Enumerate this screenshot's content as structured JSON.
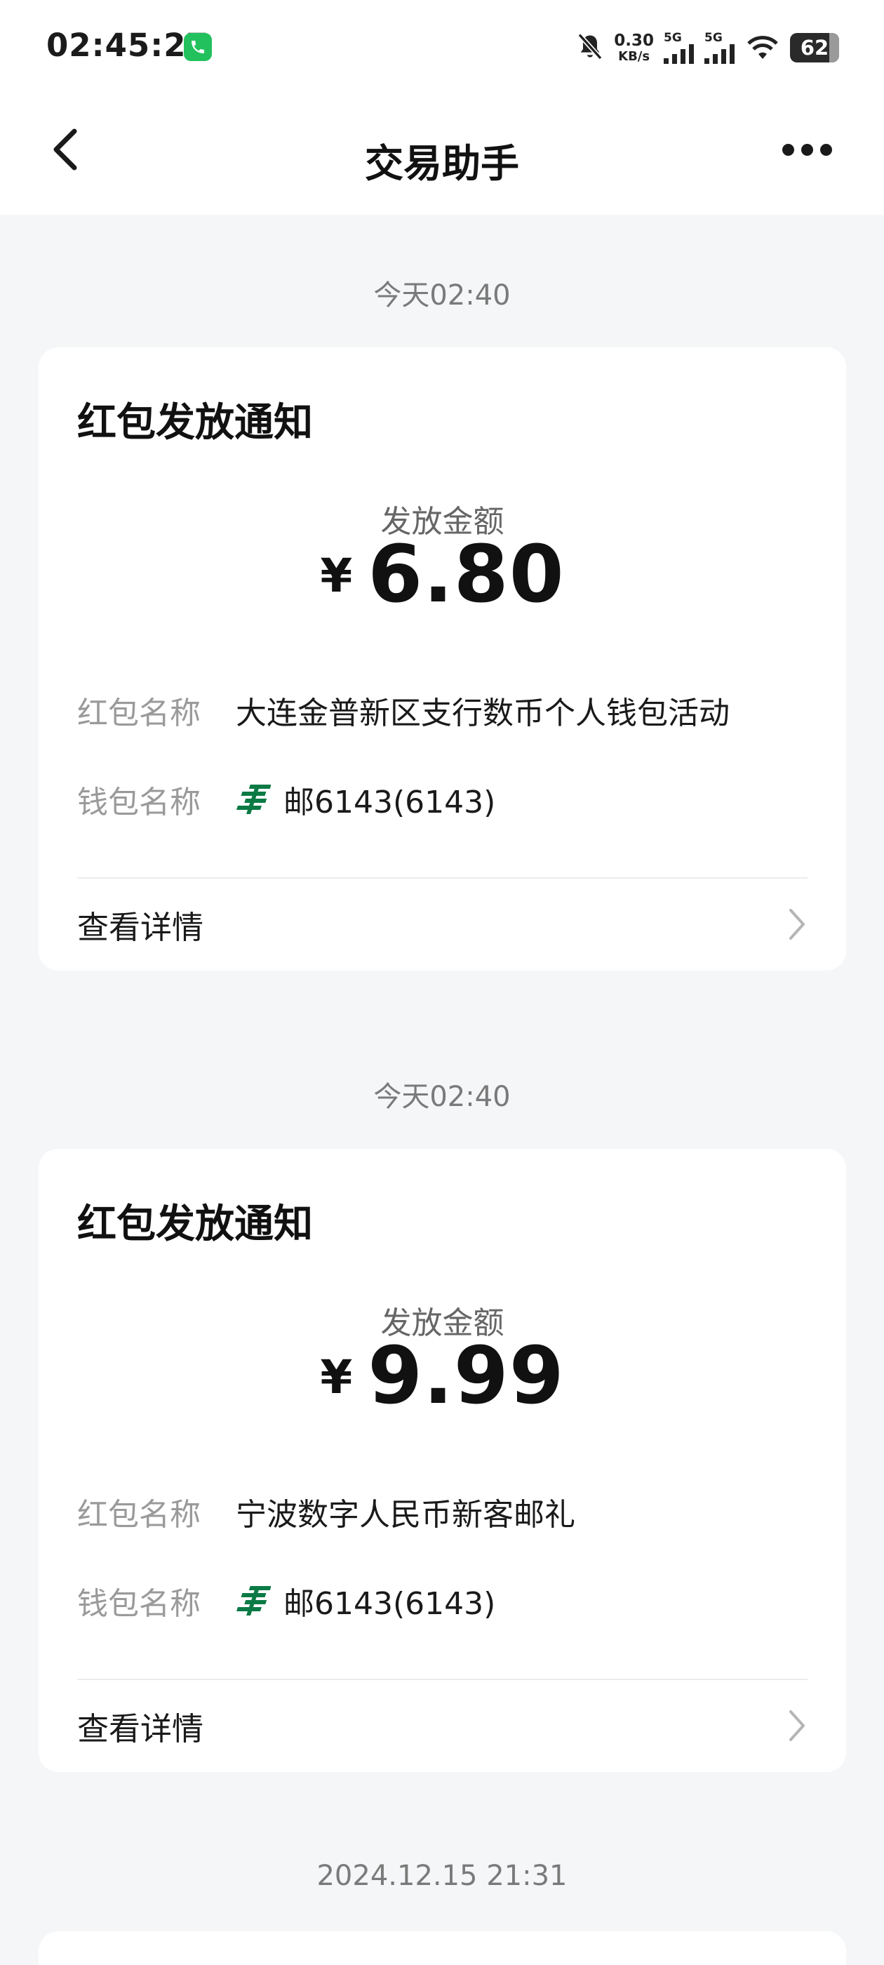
{
  "status_bar": {
    "time": "02:45:27",
    "net_speed_value": "0.30",
    "net_speed_unit": "KB/s",
    "sim1_label": "5G",
    "sim2_label": "5G",
    "battery": "62",
    "accent_call": "#22c15e"
  },
  "header": {
    "title": "交易助手"
  },
  "notifications": [
    {
      "timestamp": "今天02:40",
      "title": "红包发放通知",
      "amount_label": "发放金额",
      "currency": "¥",
      "amount": "6.80",
      "name_key": "红包名称",
      "name_value": "大连金普新区支行数币个人钱包活动",
      "wallet_key": "钱包名称",
      "wallet_value": "邮6143(6143)",
      "detail_label": "查看详情"
    },
    {
      "timestamp": "今天02:40",
      "title": "红包发放通知",
      "amount_label": "发放金额",
      "currency": "¥",
      "amount": "9.99",
      "name_key": "红包名称",
      "name_value": "宁波数字人民币新客邮礼",
      "wallet_key": "钱包名称",
      "wallet_value": "邮6143(6143)",
      "detail_label": "查看详情"
    }
  ],
  "next_timestamp": "2024.12.15 21:31",
  "icons": {
    "back": "chevron-left-icon",
    "more": "more-horizontal-icon",
    "bank": "postal-bank-logo-icon",
    "detail": "chevron-right-icon"
  }
}
